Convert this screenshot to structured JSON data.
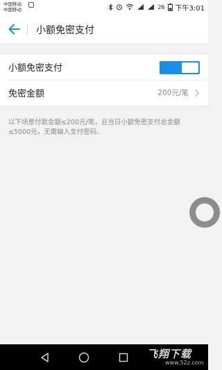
{
  "status_bar": {
    "carrier_1": "中国移动",
    "carrier_2": "中国移动",
    "battery": "26",
    "time": "下午3:01"
  },
  "header": {
    "title": "小额免密支付"
  },
  "settings": {
    "toggle_row": {
      "label": "小额免密支付",
      "enabled": true
    },
    "amount_row": {
      "label": "免密金额",
      "value": "200元/笔"
    }
  },
  "description": "以下场景付款金额≤200元/笔，且当日小额免密支付总金额≤5000元，无需输入支付密码。",
  "watermark": {
    "main": "飞翔下载",
    "sub": "www.52z.com"
  },
  "colors": {
    "accent": "#1c8ee8",
    "background": "#f2f2f2",
    "nav_bar": "#000000"
  },
  "icons": {
    "back": "arrow-left-icon",
    "chevron": "chevron-right-icon",
    "bluetooth": "bluetooth-icon",
    "alarm": "alarm-icon",
    "wifi": "wifi-icon",
    "signal": "signal-icon",
    "battery": "battery-icon",
    "nav_back": "triangle-back-icon",
    "nav_home": "circle-home-icon",
    "nav_recent": "square-recent-icon"
  }
}
